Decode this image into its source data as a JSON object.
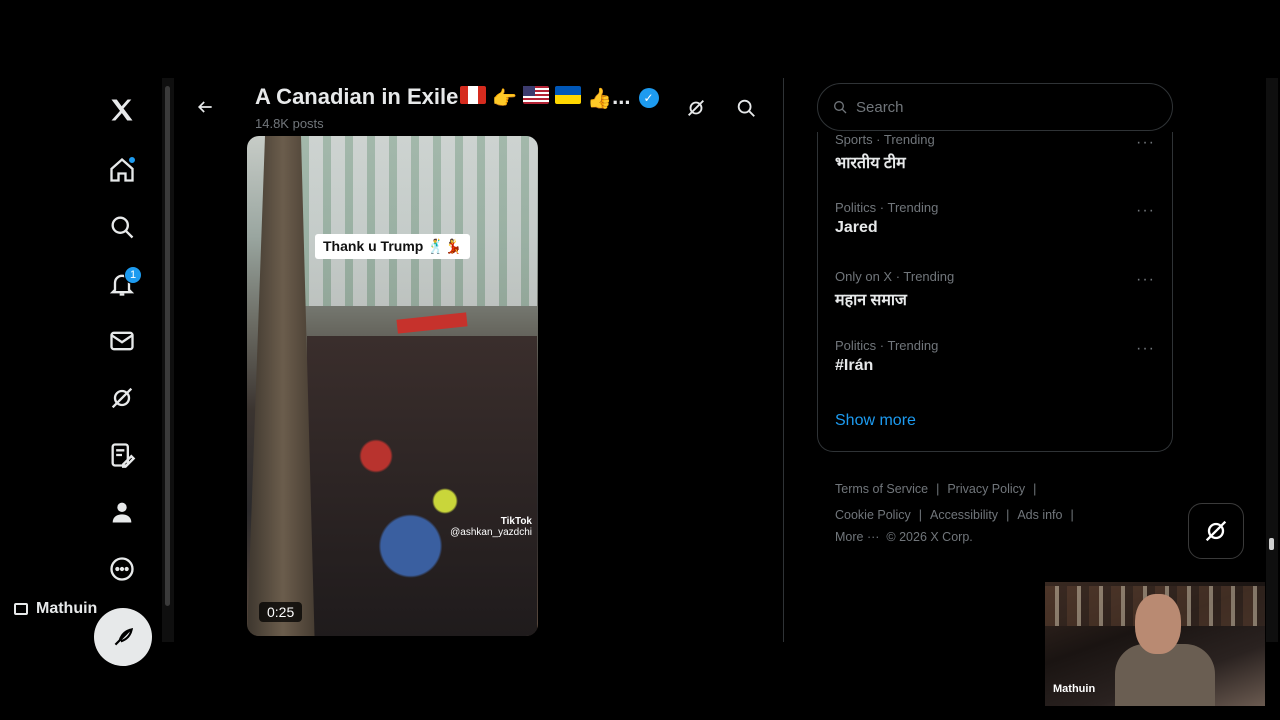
{
  "nav": {
    "notifications_badge": "1",
    "account_name": "Mathuin"
  },
  "header": {
    "title": "A Canadian in Exile",
    "title_suffix": "...",
    "subtitle": "14.8K posts"
  },
  "video": {
    "caption": "Thank u Trump 🕺💃",
    "watermark": "TikTok",
    "watermark_handle": "@ashkan_yazdchi",
    "duration": "0:25"
  },
  "search": {
    "placeholder": "Search"
  },
  "trends": [
    {
      "meta": "Sports · Trending",
      "name": "भारतीय टीम"
    },
    {
      "meta": "Politics · Trending",
      "name": "Jared"
    },
    {
      "meta": "Only on X · Trending",
      "name": "महान समाज"
    },
    {
      "meta": "Politics · Trending",
      "name": "#Irán"
    }
  ],
  "show_more": "Show more",
  "footer": {
    "terms": "Terms of Service",
    "privacy": "Privacy Policy",
    "cookie": "Cookie Policy",
    "accessibility": "Accessibility",
    "ads": "Ads info",
    "more": "More ···",
    "copyright": "© 2026 X Corp."
  },
  "webcam": {
    "label": "Mathuin"
  }
}
